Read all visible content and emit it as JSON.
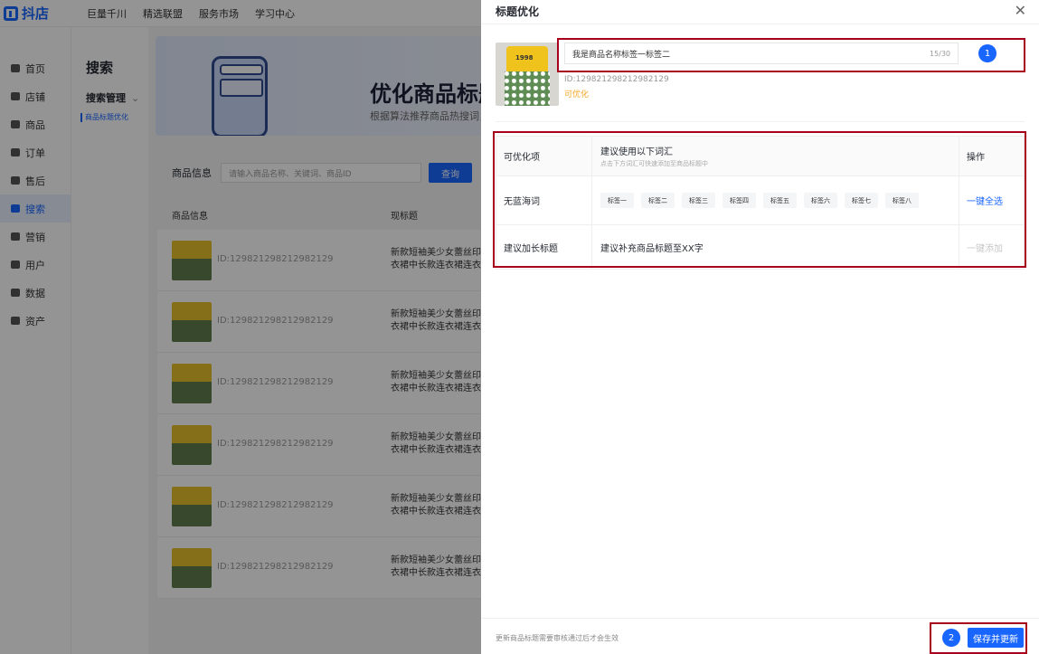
{
  "app": {
    "logo_text": "抖店",
    "top_nav": [
      "巨量千川",
      "精选联盟",
      "服务市场",
      "学习中心"
    ]
  },
  "sidebar": {
    "items": [
      {
        "label": "首页",
        "icon": "home-icon"
      },
      {
        "label": "店铺",
        "icon": "store-icon"
      },
      {
        "label": "商品",
        "icon": "goods-icon"
      },
      {
        "label": "订单",
        "icon": "order-icon"
      },
      {
        "label": "售后",
        "icon": "after-sale-icon"
      },
      {
        "label": "搜索",
        "icon": "search-icon",
        "active": true
      },
      {
        "label": "营销",
        "icon": "marketing-icon"
      },
      {
        "label": "用户",
        "icon": "user-icon"
      },
      {
        "label": "数据",
        "icon": "data-icon"
      },
      {
        "label": "资产",
        "icon": "asset-icon"
      }
    ]
  },
  "subsidebar": {
    "title": "搜索",
    "group": "搜索管理",
    "item": "商品标题优化"
  },
  "main": {
    "banner_title": "优化商品标题",
    "banner_sub": "根据算法推荐商品热搜词，",
    "search_label": "商品信息",
    "search_placeholder": "请输入商品名称、关键词、商品ID",
    "search_button": "查询",
    "col_product": "商品信息",
    "col_title": "现标题",
    "rows": [
      {
        "id": "ID:129821298212982129",
        "title1": "新款短袖美少女蕾丝印花",
        "title2": "衣裙中长款连衣裙连衣裙"
      },
      {
        "id": "ID:129821298212982129",
        "title1": "新款短袖美少女蕾丝印花",
        "title2": "衣裙中长款连衣裙连衣裙"
      },
      {
        "id": "ID:129821298212982129",
        "title1": "新款短袖美少女蕾丝印花",
        "title2": "衣裙中长款连衣裙连衣裙"
      },
      {
        "id": "ID:129821298212982129",
        "title1": "新款短袖美少女蕾丝印花",
        "title2": "衣裙中长款连衣裙连衣裙"
      },
      {
        "id": "ID:129821298212982129",
        "title1": "新款短袖美少女蕾丝印花",
        "title2": "衣裙中长款连衣裙连衣裙"
      },
      {
        "id": "ID:129821298212982129",
        "title1": "新款短袖美少女蕾丝印花",
        "title2": "衣裙中长款连衣裙连衣裙"
      }
    ]
  },
  "drawer": {
    "title": "标题优化",
    "product_title_value": "我是商品名称标签一标签二",
    "title_count": "15/30",
    "product_id": "ID:129821298212982129",
    "product_status": "可优化",
    "step1": "1",
    "step2": "2",
    "table": {
      "col1": "可优化项",
      "col2": "建议使用以下词汇",
      "col2_sub": "点击下方词汇可快速添加至商品标题中",
      "col3": "操作",
      "row1_label": "无蓝海词",
      "row1_tags": [
        "标签一",
        "标签二",
        "标签三",
        "标签四",
        "标签五",
        "标签六",
        "标签七",
        "标签八"
      ],
      "row1_action": "一键全选",
      "row2_label": "建议加长标题",
      "row2_text": "建议补充商品标题至XX字",
      "row2_action": "一键添加"
    },
    "footer_note": "更新商品标题需要审核通过后才会生效",
    "save_button": "保存并更新"
  },
  "colors": {
    "accent": "#1966ff",
    "highlight_box": "#a8001c",
    "status_warning": "#f5a623"
  }
}
